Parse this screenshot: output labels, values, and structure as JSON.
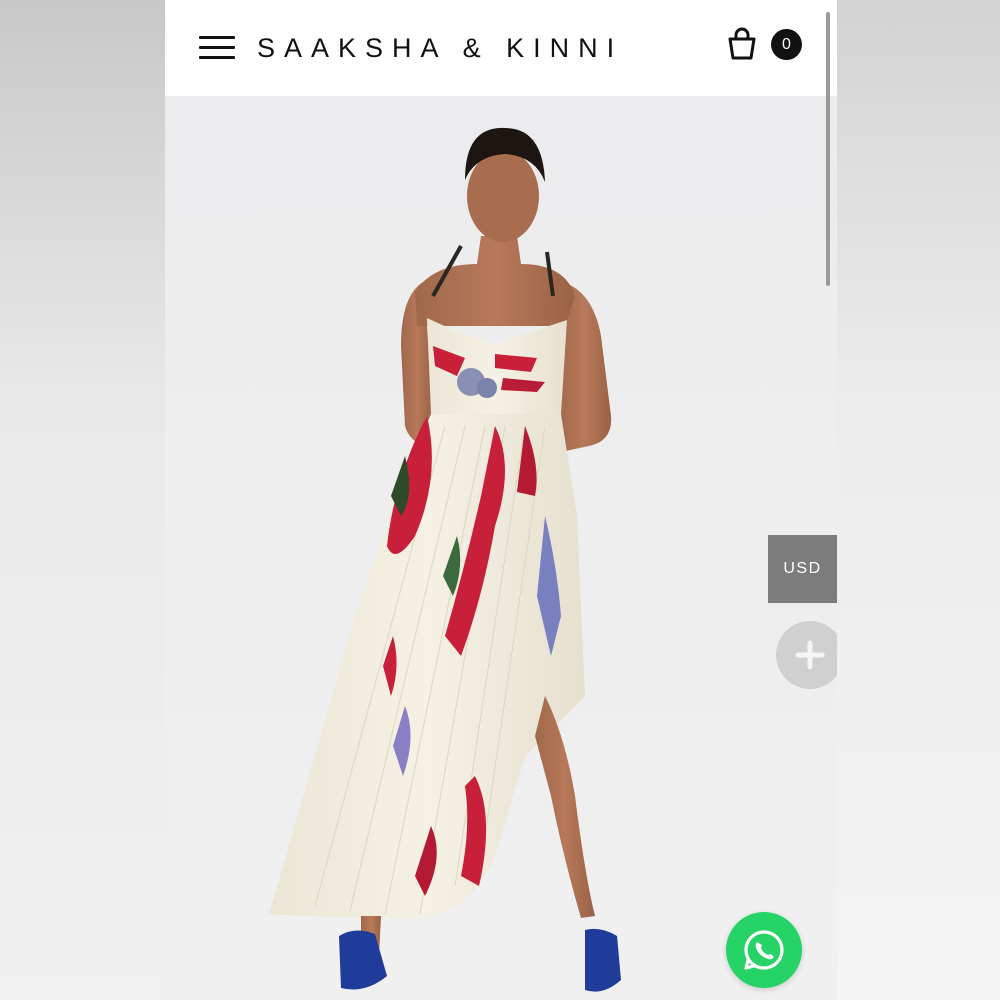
{
  "header": {
    "brand": "SAAKSHA & KINNI",
    "cart_count": "0",
    "menu_icon": "hamburger-menu-icon",
    "cart_icon": "shopping-bag-icon"
  },
  "product_image": {
    "alt": "Model wearing cream pleated asymmetric halter dress with red ikat print and blue heels"
  },
  "floating": {
    "currency_label": "USD",
    "expand_icon": "plus-icon",
    "chat_icon": "whatsapp-icon"
  },
  "colors": {
    "header_bg": "#ffffff",
    "brand_text": "#111111",
    "badge_bg": "#111111",
    "currency_bg": "#7c7c7c",
    "whatsapp": "#25d366"
  }
}
